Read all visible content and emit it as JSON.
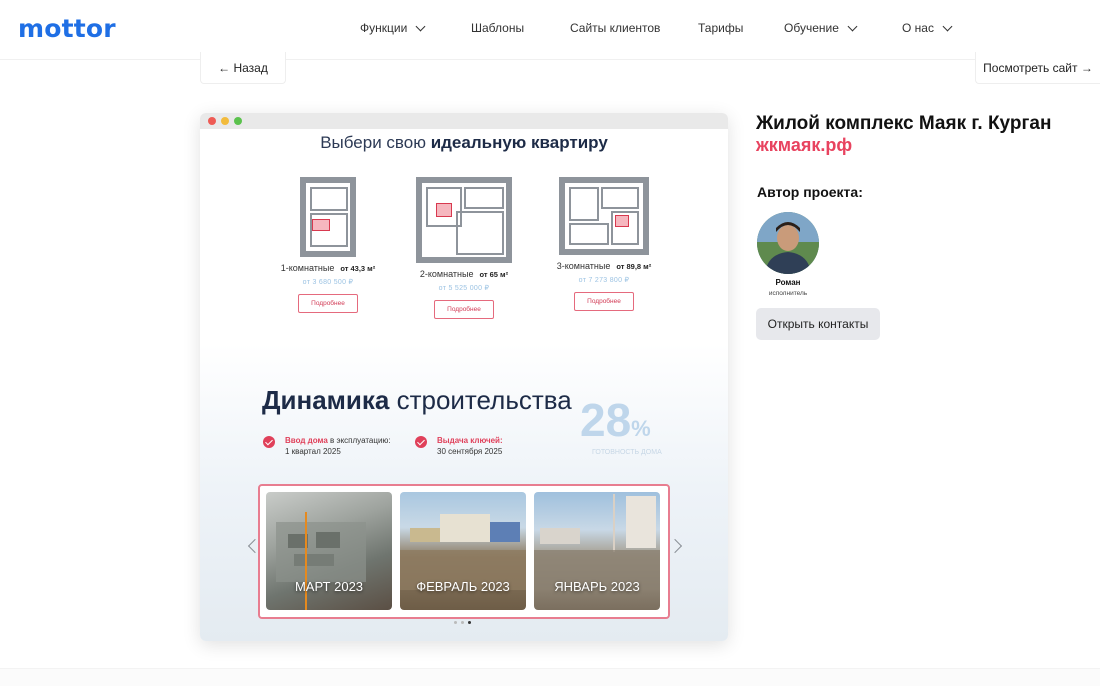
{
  "header": {
    "logo": "mottor",
    "nav": [
      {
        "label": "Функции",
        "dropdown": true
      },
      {
        "label": "Шаблоны",
        "dropdown": false
      },
      {
        "label": "Сайты клиентов",
        "dropdown": false
      },
      {
        "label": "Тарифы",
        "dropdown": false
      },
      {
        "label": "Обучение",
        "dropdown": true
      },
      {
        "label": "О нас",
        "dropdown": true
      }
    ]
  },
  "actions": {
    "back": "← Назад",
    "view_site": "Посмотреть сайт →"
  },
  "preview": {
    "title_plain": "Выбери свою ",
    "title_bold": "идеальную квартиру",
    "plans": [
      {
        "rooms": "1-комнатные",
        "area": "от 43,3 м²",
        "price": "от 3 680 500 ₽",
        "button": "Подробнее",
        "number": "1"
      },
      {
        "rooms": "2-комнатные",
        "area": "от 65 м²",
        "price": "от 5 525 000 ₽",
        "button": "Подробнее",
        "number": "2"
      },
      {
        "rooms": "3-комнатные",
        "area": "от 89,8 м²",
        "price": "от 7 273 800 ₽",
        "button": "Подробнее",
        "number": "3"
      }
    ],
    "dynamics_bold": "Динамика",
    "dynamics_plain": " строительства",
    "percent_value": "28",
    "percent_sign": "%",
    "percent_caption": "ГОТОВНОСТЬ ДОМА",
    "milestones": [
      {
        "label_red": "Ввод дома",
        "label_rest": " в эксплуатацию:",
        "value": "1 квартал 2025"
      },
      {
        "label_red": "Выдача ключей:",
        "label_rest": "",
        "value": "30  сентября 2025"
      }
    ],
    "photos": [
      {
        "label": "МАРТ 2023"
      },
      {
        "label": "ФЕВРАЛЬ 2023"
      },
      {
        "label": "ЯНВАРЬ 2023"
      }
    ],
    "slide_page": 3,
    "slide_count": 3
  },
  "project": {
    "title": "Жилой комплекс Маяк г. Курган",
    "link": "жкмаяк.рф",
    "author_heading": "Автор проекта:",
    "author_name": "Роман",
    "author_role": "исполнитель",
    "contact_button": "Открыть контакты"
  },
  "colors": {
    "brand": "#1f6fe5",
    "accent": "#e8435f",
    "navy": "#1d2b47"
  }
}
